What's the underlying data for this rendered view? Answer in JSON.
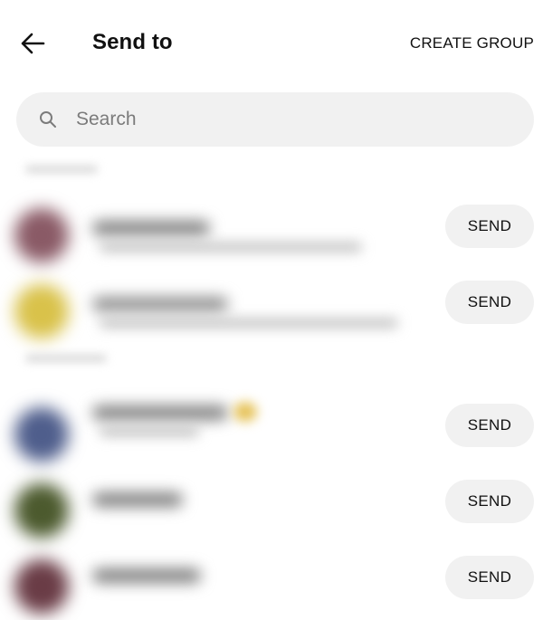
{
  "header": {
    "title": "Send to",
    "create_group_label": "CREATE GROUP",
    "back_icon": "arrow-left-icon"
  },
  "search": {
    "placeholder": "Search",
    "value": "",
    "icon": "search-icon"
  },
  "contacts": [
    {
      "send_label": "SEND",
      "avatar_color": "#8a5a66"
    },
    {
      "send_label": "SEND",
      "avatar_color": "#d9c24a"
    },
    {
      "send_label": "SEND",
      "avatar_color": "#4f5e8c"
    },
    {
      "send_label": "SEND",
      "avatar_color": "#4c5a2e"
    },
    {
      "send_label": "SEND",
      "avatar_color": "#6a3c46"
    }
  ]
}
